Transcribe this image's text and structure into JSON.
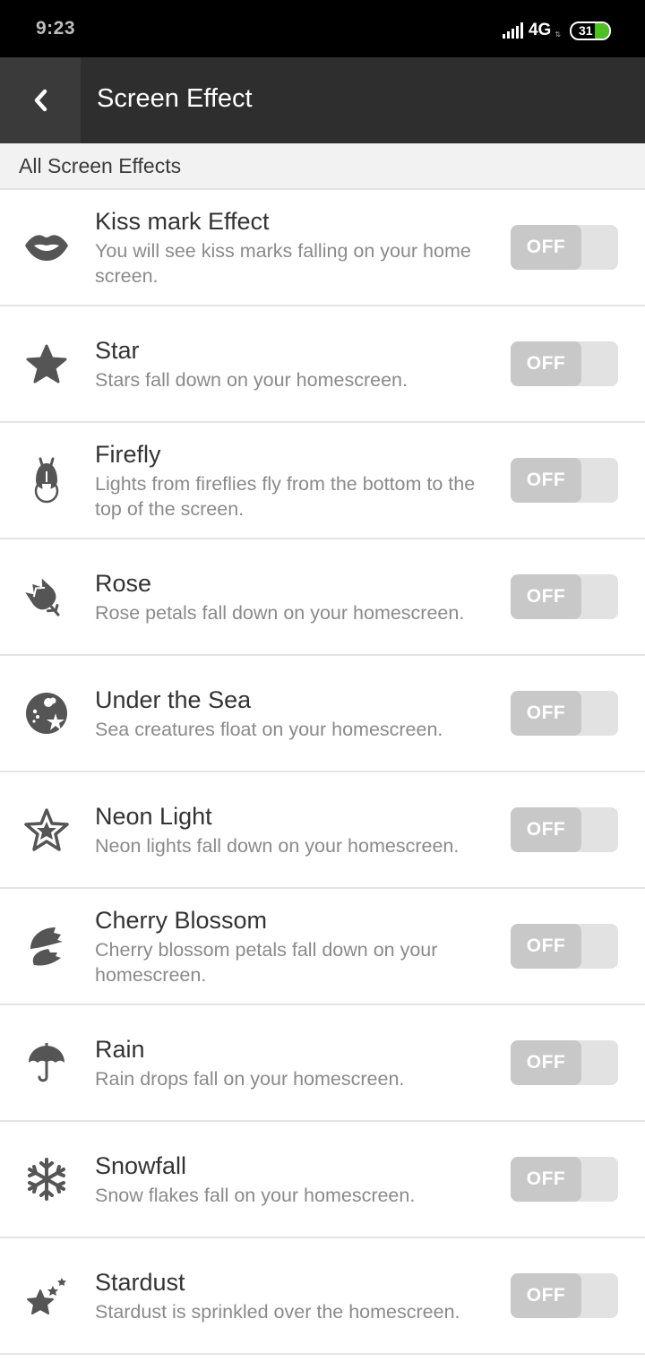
{
  "status_bar": {
    "time": "9:23",
    "network": "4G",
    "battery_level": "31",
    "battery_color": "#4cc21f"
  },
  "app_bar": {
    "back_icon": "chevron-left-icon",
    "title": "Screen Effect"
  },
  "section": {
    "title": "All Screen Effects"
  },
  "effects": [
    {
      "icon": "lips-icon",
      "title": "Kiss mark Effect",
      "description": "You will see kiss marks falling on your home screen.",
      "toggle": "OFF"
    },
    {
      "icon": "star-icon",
      "title": "Star",
      "description": "Stars fall down on your homescreen.",
      "toggle": "OFF"
    },
    {
      "icon": "firefly-icon",
      "title": "Firefly",
      "description": "Lights from fireflies fly from the bottom to the top of the screen.",
      "toggle": "OFF"
    },
    {
      "icon": "rose-icon",
      "title": "Rose",
      "description": "Rose petals fall down on your homescreen.",
      "toggle": "OFF"
    },
    {
      "icon": "sea-globe-icon",
      "title": "Under the Sea",
      "description": "Sea creatures float on your homescreen.",
      "toggle": "OFF"
    },
    {
      "icon": "neon-star-icon",
      "title": "Neon Light",
      "description": "Neon lights fall down on your homescreen.",
      "toggle": "OFF"
    },
    {
      "icon": "cherry-blossom-icon",
      "title": "Cherry Blossom",
      "description": "Cherry blossom petals fall down on your homescreen.",
      "toggle": "OFF"
    },
    {
      "icon": "umbrella-icon",
      "title": "Rain",
      "description": "Rain drops fall on your homescreen.",
      "toggle": "OFF"
    },
    {
      "icon": "snowflake-icon",
      "title": "Snowfall",
      "description": "Snow flakes fall on your homescreen.",
      "toggle": "OFF"
    },
    {
      "icon": "stardust-icon",
      "title": "Stardust",
      "description": "Stardust is sprinkled over the homescreen.",
      "toggle": "OFF"
    }
  ]
}
